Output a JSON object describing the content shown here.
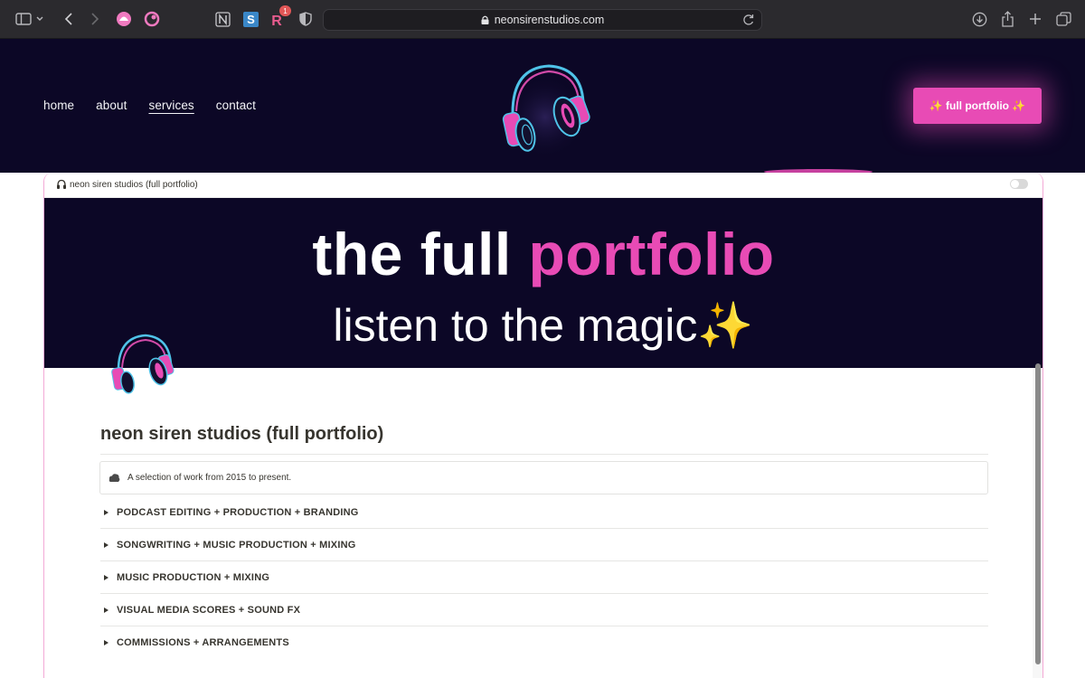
{
  "browser": {
    "url": "neonsirenstudios.com",
    "extension_badge": "1",
    "icons": [
      "sidebar-icon",
      "chevron-down-icon",
      "back-icon",
      "forward-icon",
      "extension-pink-icon",
      "extension-pink-ring-icon",
      "notion-icon",
      "simplenote-icon",
      "readwise-icon",
      "shield-icon",
      "lock-icon",
      "reload-icon",
      "download-icon",
      "share-icon",
      "new-tab-icon",
      "tabs-icon"
    ]
  },
  "site": {
    "nav": [
      {
        "label": "home"
      },
      {
        "label": "about"
      },
      {
        "label": "services"
      },
      {
        "label": "contact"
      }
    ],
    "cta_label": "✨ full portfolio ✨"
  },
  "embed": {
    "title": "neon siren studios (full portfolio)",
    "banner_line1_white": "the full ",
    "banner_line1_pink": "portfolio",
    "banner_line2": "listen to the magic",
    "banner_sparkle": "✨",
    "page_title": "neon siren studios (full portfolio)",
    "callout": "A selection of work from 2015 to present.",
    "toggles": [
      {
        "label": "PODCAST EDITING + PRODUCTION + BRANDING"
      },
      {
        "label": "SONGWRITING + MUSIC PRODUCTION + MIXING"
      },
      {
        "label": "MUSIC PRODUCTION + MIXING"
      },
      {
        "label": "VISUAL MEDIA SCORES + SOUND FX"
      },
      {
        "label": "COMMISSIONS + ARRANGEMENTS"
      }
    ]
  },
  "colors": {
    "header_bg": "#0c0726",
    "accent_pink": "#e84bb5",
    "chrome_bg": "#2b2a2e",
    "neon_blue": "#4fc3e8"
  }
}
